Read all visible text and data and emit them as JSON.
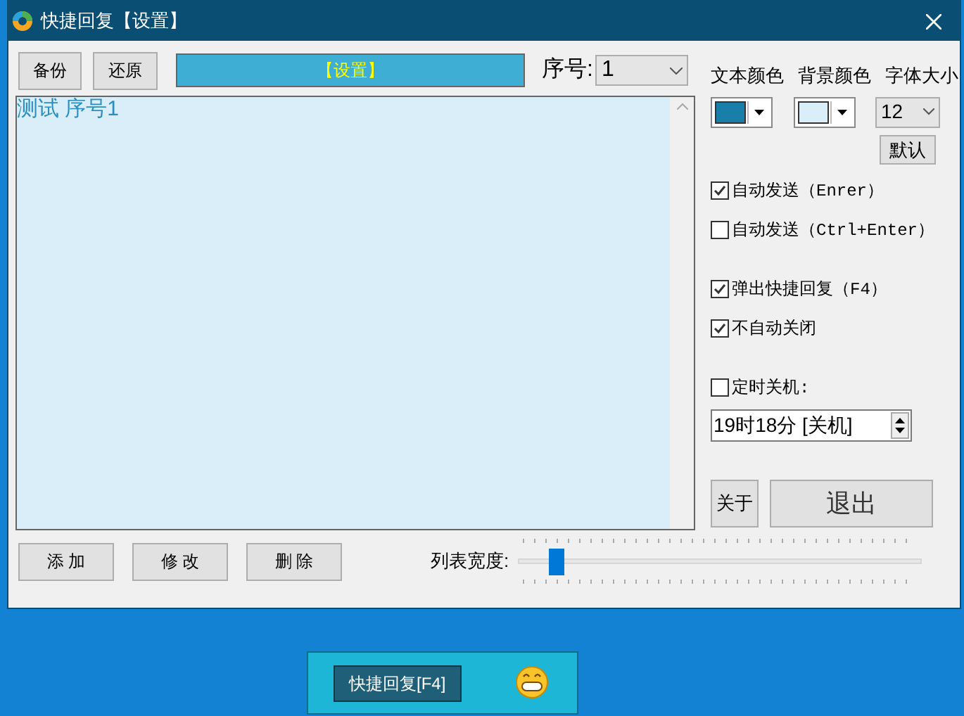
{
  "window": {
    "title": "快捷回复【设置】"
  },
  "toolbar": {
    "buttons": [
      "备份",
      "还原"
    ],
    "banner": "【设置】",
    "index_label": "序号:",
    "index_value": "1"
  },
  "editor": {
    "text": "测试 序号1"
  },
  "bottom": {
    "buttons": [
      "添 加",
      "修 改",
      "删 除"
    ],
    "width_label": "列表宽度:",
    "width_slider": {
      "level": 0.08
    }
  },
  "settings": {
    "text_color": {
      "label": "文本颜色",
      "color": "#1a7fa8"
    },
    "bg_color": {
      "label": "背景颜色",
      "color": "#d9eef9"
    },
    "font_size": {
      "label": "字体大小",
      "value": "12"
    },
    "default_button": "默认",
    "option_groups": [
      [
        {
          "label": "自动发送（Enrer）",
          "checked": true
        },
        {
          "label": "自动发送（Ctrl+Enter）",
          "checked": false
        }
      ],
      [
        {
          "label": "弹出快捷回复（F4）",
          "checked": true
        },
        {
          "label": "不自动关闭",
          "checked": true
        }
      ],
      [
        {
          "label": "定时关机:",
          "checked": false
        }
      ]
    ],
    "timer_value": "19时18分 [关机]",
    "about_button": "关于",
    "exit_button": "退出"
  },
  "desktop_widget": {
    "label": "快捷回复[F4]"
  }
}
